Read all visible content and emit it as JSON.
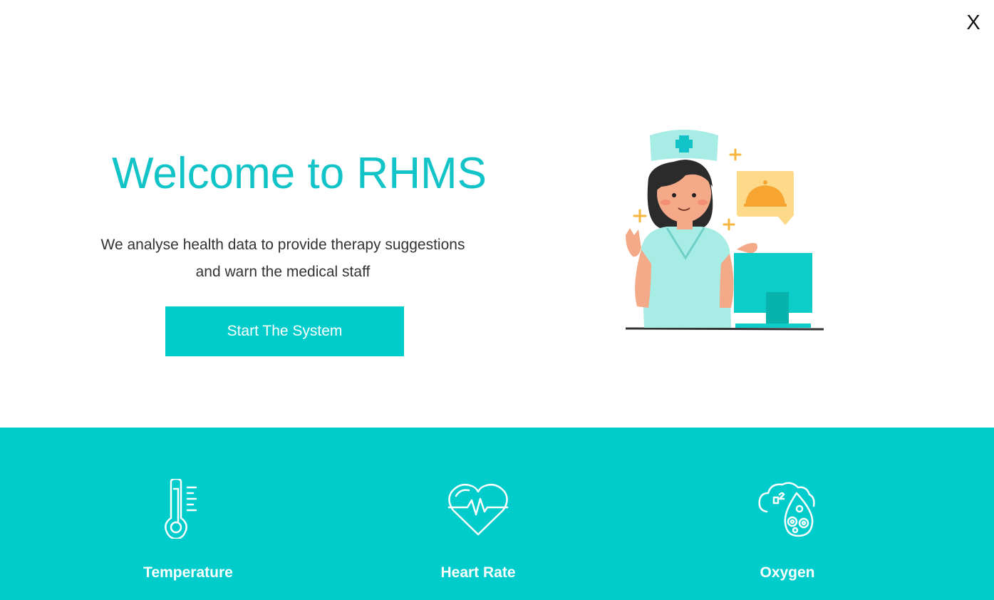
{
  "window": {
    "close_label": "X"
  },
  "hero": {
    "title": "Welcome to RHMS",
    "subtitle_line1": "We analyse health data to provide therapy suggestions",
    "subtitle_line2": "and warn the medical staff",
    "start_button_label": "Start The System"
  },
  "metrics": [
    {
      "label": "Temperature",
      "icon": "thermometer-icon"
    },
    {
      "label": "Heart Rate",
      "icon": "heart-rate-icon"
    },
    {
      "label": "Oxygen",
      "icon": "oxygen-icon"
    }
  ],
  "colors": {
    "accent": "#00cccc",
    "title": "#12c4c8",
    "text": "#333333",
    "background": "#ffffff"
  }
}
